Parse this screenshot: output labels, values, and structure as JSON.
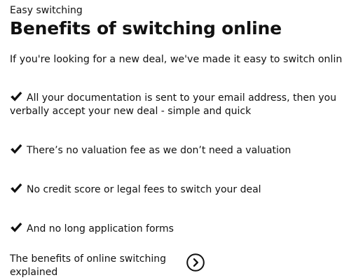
{
  "eyebrow": "Easy switching",
  "heading": "Benefits of switching online",
  "intro": "If you're looking for a new deal, we've made it easy to switch online.",
  "benefits": [
    {
      "text": "All your documentation is sent to your email address, then you verbally accept your new deal - simple and quick",
      "icon": "checkmark-icon"
    },
    {
      "text": "There’s no valuation fee as we don’t need a valuation",
      "icon": "checkmark-icon"
    },
    {
      "text": "No credit score or legal fees to switch your deal",
      "icon": "checkmark-icon"
    },
    {
      "text": "And no long application forms",
      "icon": "checkmark-icon"
    }
  ],
  "link": {
    "label": "The benefits of online switching explained",
    "icon": "chevron-right-circle-icon"
  },
  "colors": {
    "text": "#111111",
    "background": "#ffffff"
  }
}
